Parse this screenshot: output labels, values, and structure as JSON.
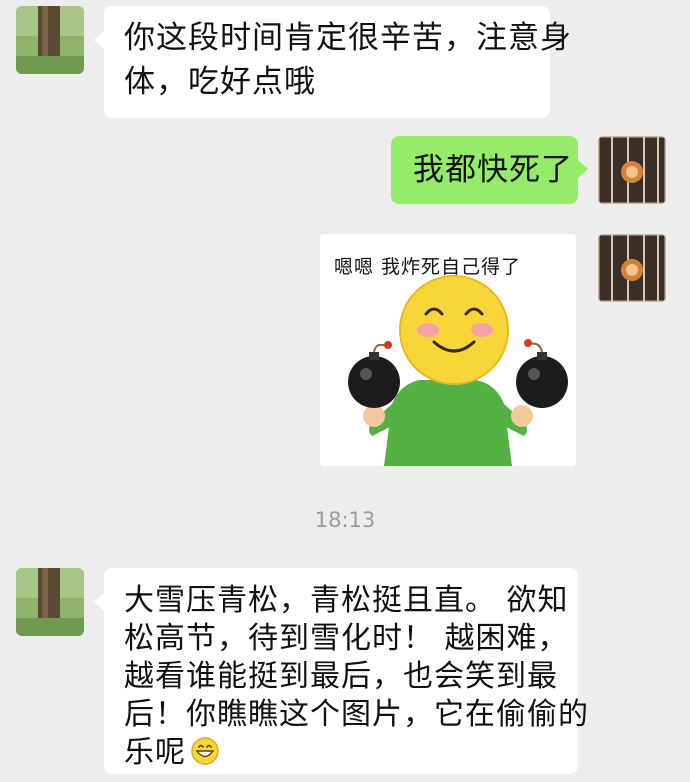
{
  "chat": {
    "messages": [
      {
        "sender": "contact",
        "lines": [
          "你这段时间肯定很辛苦，注意身",
          "体，吃好点哦"
        ]
      },
      {
        "sender": "me",
        "text": "我都快死了"
      },
      {
        "sender": "me",
        "sticker_caption": "嗯嗯  我炸死自己得了",
        "sticker_icon": "smiley-holding-bombs"
      },
      {
        "sender": "contact",
        "lines": [
          "大雪压青松，青松挺且直。  欲知",
          "松高节，待到雪化时！  越困难，",
          "越看谁能挺到最后，也会笑到最",
          "后！你瞧瞧这个图片，它在偷偷的",
          "乐呢"
        ],
        "emoji": "grinning-face-emoji"
      }
    ],
    "timestamp": "18:13"
  },
  "colors": {
    "background": "#ededed",
    "incoming_bubble": "#ffffff",
    "outgoing_bubble": "#95ec69",
    "timestamp_text": "#9a9a9a"
  }
}
